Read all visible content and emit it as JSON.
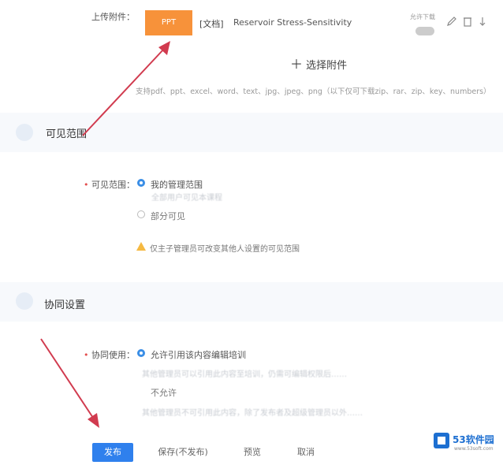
{
  "upload": {
    "label": "上传附件：",
    "file_type_badge": "PPT",
    "file_prefix": "[文档]",
    "file_name": "Reservoir Stress-Sensitivity",
    "download_hint": "允许下载",
    "add_button": "选择附件",
    "formats_hint": "支持pdf、ppt、excel、word、text、jpg、jpeg、png（以下仅可下载zip、rar、zip、key、numbers）"
  },
  "visibility": {
    "section_title": "可见范围",
    "field_label": "可见范围：",
    "option_managed": "我的管理范围",
    "option_managed_sub": "全部用户可见本课程",
    "option_partial": "部分可见",
    "warning_text": "仅主子管理员可改变其他人设置的可见范围"
  },
  "collab": {
    "section_title": "协同设置",
    "field_label": "协同使用：",
    "option_allow": "允许引用该内容编辑培训",
    "option_allow_sub": "其他管理员可以引用此内容至培训，仍需可编辑权限后……",
    "option_deny": "不允许",
    "option_deny_sub": "其他管理员不可引用此内容，除了发布者及超级管理员以外……"
  },
  "actions": {
    "publish": "发布",
    "save": "保存(不发布)",
    "preview": "预览",
    "cancel": "取消"
  },
  "watermark": {
    "brand": "53软件园",
    "url": "www.53soft.com"
  },
  "colors": {
    "accent": "#2f80ed",
    "badge": "#f7923a",
    "arrow": "#d13b4f"
  }
}
